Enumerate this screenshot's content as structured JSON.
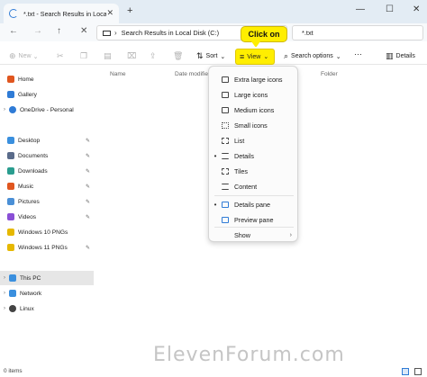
{
  "tab": {
    "title": "*.txt - Search Results in Local D",
    "close": "✕",
    "new_tab": "+"
  },
  "window_controls": {
    "minimize": "—",
    "maximize": "☐",
    "close": "✕"
  },
  "nav": {
    "back": "←",
    "forward": "→",
    "up": "↑",
    "refresh": "✕"
  },
  "address": {
    "separator": "›",
    "path": "Search Results in Local Disk (C:)"
  },
  "search": {
    "value": "*.txt"
  },
  "callout": {
    "text": "Click on"
  },
  "toolbar": {
    "new_label": "New",
    "sort_label": "Sort",
    "view_label": "View",
    "search_options_label": "Search options",
    "more": "···",
    "details_label": "Details"
  },
  "sidebar": {
    "items": [
      {
        "label": "Home",
        "color": "#e0561f"
      },
      {
        "label": "Gallery",
        "color": "#2f7bd6"
      },
      {
        "label": "OneDrive - Personal",
        "color": "#2f7bd6"
      },
      {
        "label": "Desktop",
        "color": "#3a8fde"
      },
      {
        "label": "Documents",
        "color": "#5a6b8a"
      },
      {
        "label": "Downloads",
        "color": "#2a9d8f"
      },
      {
        "label": "Music",
        "color": "#e0561f"
      },
      {
        "label": "Pictures",
        "color": "#4a8fd6"
      },
      {
        "label": "Videos",
        "color": "#8a4fd6"
      },
      {
        "label": "Windows 10 PNGs",
        "color": "#e6b800"
      },
      {
        "label": "Windows 11 PNGs",
        "color": "#e6b800"
      },
      {
        "label": "This PC",
        "color": "#3a8fde"
      },
      {
        "label": "Network",
        "color": "#3a8fde"
      },
      {
        "label": "Linux",
        "color": "#444444"
      }
    ]
  },
  "columns": {
    "name": "Name",
    "date": "Date modifie",
    "folder": "Folder"
  },
  "view_menu": {
    "items": [
      {
        "label": "Extra large icons"
      },
      {
        "label": "Large icons"
      },
      {
        "label": "Medium icons"
      },
      {
        "label": "Small icons"
      },
      {
        "label": "List"
      },
      {
        "label": "Details",
        "bullet": "•"
      },
      {
        "label": "Tiles"
      },
      {
        "label": "Content"
      },
      {
        "label": "Details pane",
        "bullet": "•"
      },
      {
        "label": "Preview pane"
      },
      {
        "label": "Show",
        "arrow": "›"
      }
    ]
  },
  "status": {
    "items": "0 items"
  },
  "watermark": "ElevenForum.com"
}
